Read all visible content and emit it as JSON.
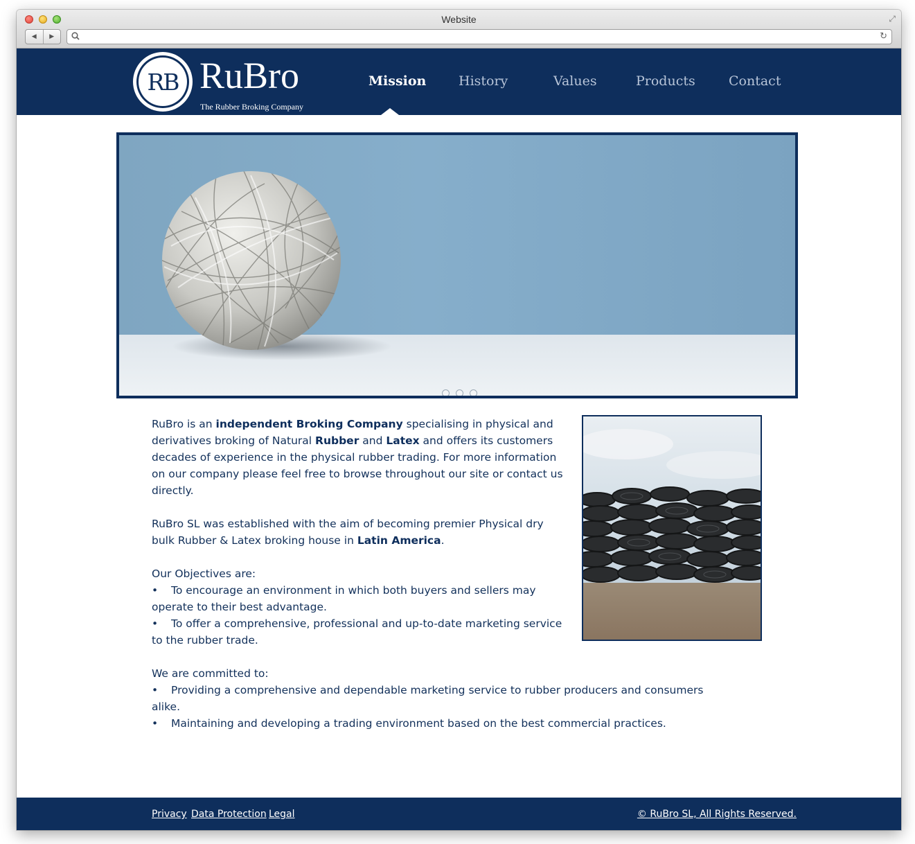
{
  "window": {
    "title": "Website"
  },
  "site": {
    "logo_monogram": "RB",
    "logo_name": "RuBro",
    "logo_tagline": "The Rubber Broking Company"
  },
  "nav": {
    "items": [
      {
        "label": "Mission",
        "active": true
      },
      {
        "label": "History",
        "active": false
      },
      {
        "label": "Values",
        "active": false
      },
      {
        "label": "Products",
        "active": false
      },
      {
        "label": "Contact",
        "active": false
      }
    ]
  },
  "hero": {
    "slide_count": 3
  },
  "content": {
    "p1": {
      "t1": "RuBro is an ",
      "b1": "independent Broking Company",
      "t2": " specialising in physical and derivatives broking of Natural ",
      "b2": "Rubber",
      "t3": " and ",
      "b3": "Latex",
      "t4": " and offers its customers decades of experience in the physical rubber trading. For more information on our company please feel free to browse throughout our site or contact us directly."
    },
    "p2": {
      "t1": "RuBro SL was established with the aim of becoming premier Physical dry bulk Rubber & Latex broking house in ",
      "b1": "Latin America",
      "t2": "."
    },
    "objectives": {
      "heading": "Our Objectives are:",
      "items": [
        "To encourage an environment in which both buyers and sellers may operate to their best advantage.",
        "To offer a comprehensive, professional and up-to-date marketing service to the rubber trade."
      ]
    },
    "commitments": {
      "heading": "We are committed to:",
      "items": [
        "Providing a comprehensive and dependable marketing service to rubber producers and consumers alike.",
        "Maintaining and developing a trading environment based on the best commercial practices."
      ]
    },
    "bullet_char": "•"
  },
  "footer": {
    "links": [
      "Privacy",
      "Data Protection",
      "Legal"
    ],
    "copyright": "© RuBro SL, All Rights Reserved."
  },
  "colors": {
    "brand_navy": "#0e2e5c",
    "nav_inactive": "#b7c4d8",
    "sky_blue": "#7fa6c1"
  },
  "icons": [
    "back-arrow-icon",
    "forward-arrow-icon",
    "search-icon",
    "reload-icon",
    "resize-icon"
  ]
}
